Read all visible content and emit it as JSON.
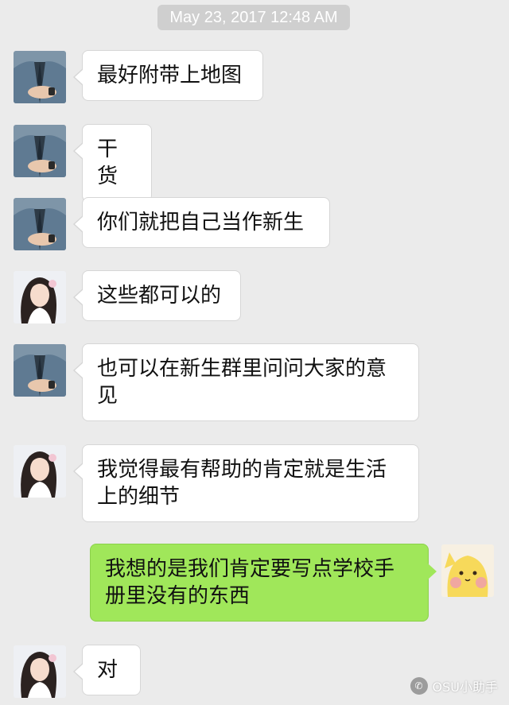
{
  "timestamp": "May 23, 2017 12:48 AM",
  "messages": [
    {
      "sender": "male-user",
      "text": "最好附带上地图"
    },
    {
      "sender": "male-user",
      "text": "干货"
    },
    {
      "sender": "male-user",
      "text": "你们就把自己当作新生"
    },
    {
      "sender": "female-user",
      "text": "这些都可以的"
    },
    {
      "sender": "male-user",
      "text": "也可以在新生群里问问大家的意见"
    },
    {
      "sender": "female-user",
      "text": "我觉得最有帮助的肯定就是生活上的细节"
    },
    {
      "sender": "self",
      "text": "我想的是我们肯定要写点学校手册里没有的东西"
    },
    {
      "sender": "female-user",
      "text": "对"
    }
  ],
  "watermark": {
    "text": "OSU小助手",
    "icon": "wechat-icon"
  },
  "colors": {
    "background": "#ebebeb",
    "incoming_bubble": "#ffffff",
    "outgoing_bubble": "#a0e75a",
    "timestamp_bg": "#cfcfcf"
  }
}
